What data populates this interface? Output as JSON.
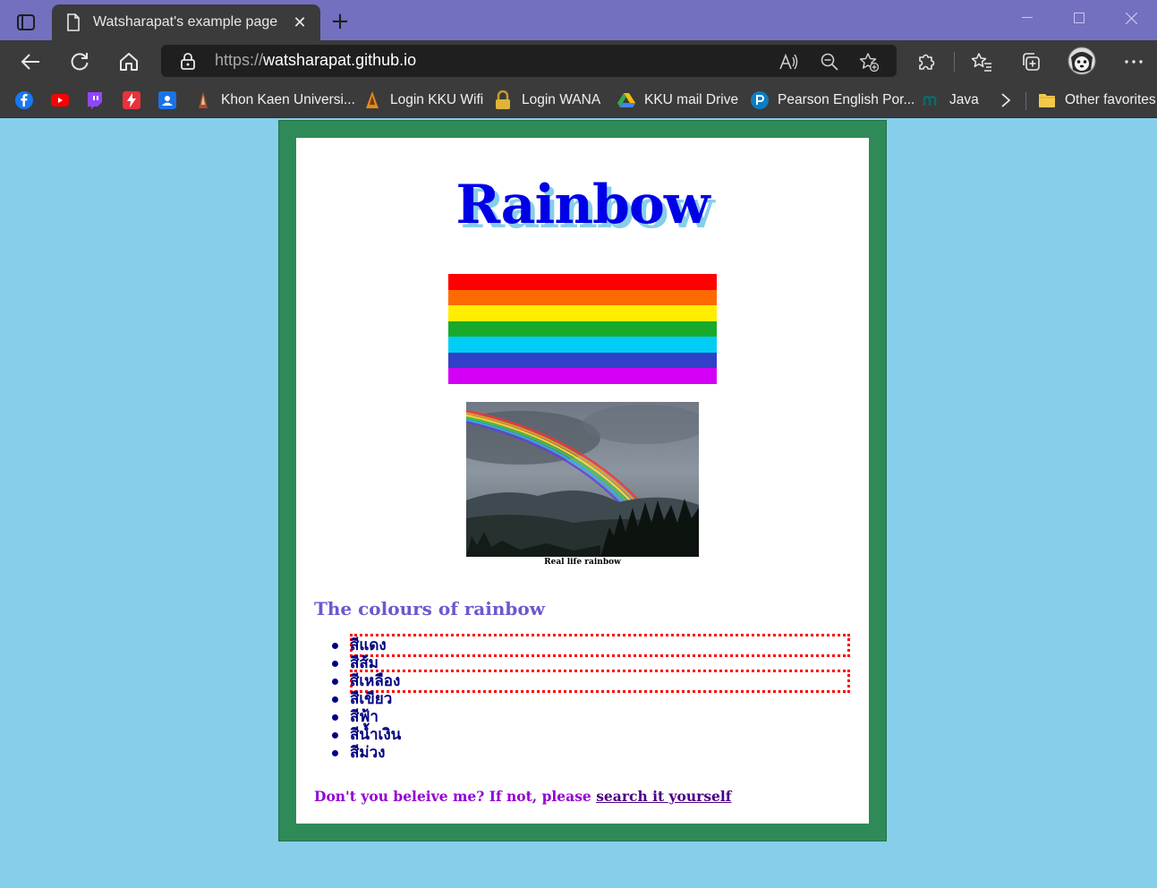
{
  "browser": {
    "tab_title": "Watsharapat's example page",
    "url_scheme": "https://",
    "url_host": "watsharapat.github.io",
    "new_tab_symbol": "+",
    "close_symbol": "✕",
    "favorites": [
      {
        "label": "",
        "icon": "facebook-icon",
        "color": "#1877f2"
      },
      {
        "label": "",
        "icon": "youtube-icon",
        "color": "#ff0000"
      },
      {
        "label": "",
        "icon": "twitch-icon",
        "color": "#9146ff"
      },
      {
        "label": "",
        "icon": "flash-icon",
        "color": "#e8323c"
      },
      {
        "label": "",
        "icon": "contacts-icon",
        "color": "#1a73e8"
      },
      {
        "label": "Khon Kaen Universi...",
        "icon": "kku-logo-icon",
        "color": "#a0522d"
      },
      {
        "label": "Login KKU Wifi",
        "icon": "kku-wifi-icon",
        "color": "#e08a1e"
      },
      {
        "label": "Login WANA",
        "icon": "padlock-icon",
        "color": "#e0b43a"
      },
      {
        "label": "KKU mail Drive",
        "icon": "google-drive-icon",
        "color": "#34a853"
      },
      {
        "label": "Pearson English Por...",
        "icon": "pearson-icon",
        "color": "#0b7ec2"
      },
      {
        "label": "Java",
        "icon": "java-m-icon",
        "color": "#0b6b6b"
      },
      {
        "label": "Other favorites",
        "icon": "folder-icon",
        "color": "#f2c94c"
      }
    ]
  },
  "page": {
    "heading": "Rainbow",
    "flag_colors": [
      "#ff0000",
      "#ff6a00",
      "#ffee00",
      "#1aaa2a",
      "#00cdf5",
      "#3040c8",
      "#d400f5"
    ],
    "photo_caption": "Real life rainbow",
    "subheading": "The colours of rainbow",
    "colours": [
      "สีแดง",
      "สีส้ม",
      "สีเหลือง",
      "สีเขียว",
      "สีฟ้า",
      "สีน้ำเงิน",
      "สีม่วง"
    ],
    "cta_text": "Don't you beleive me? If not, please ",
    "cta_link": "search it yourself"
  }
}
